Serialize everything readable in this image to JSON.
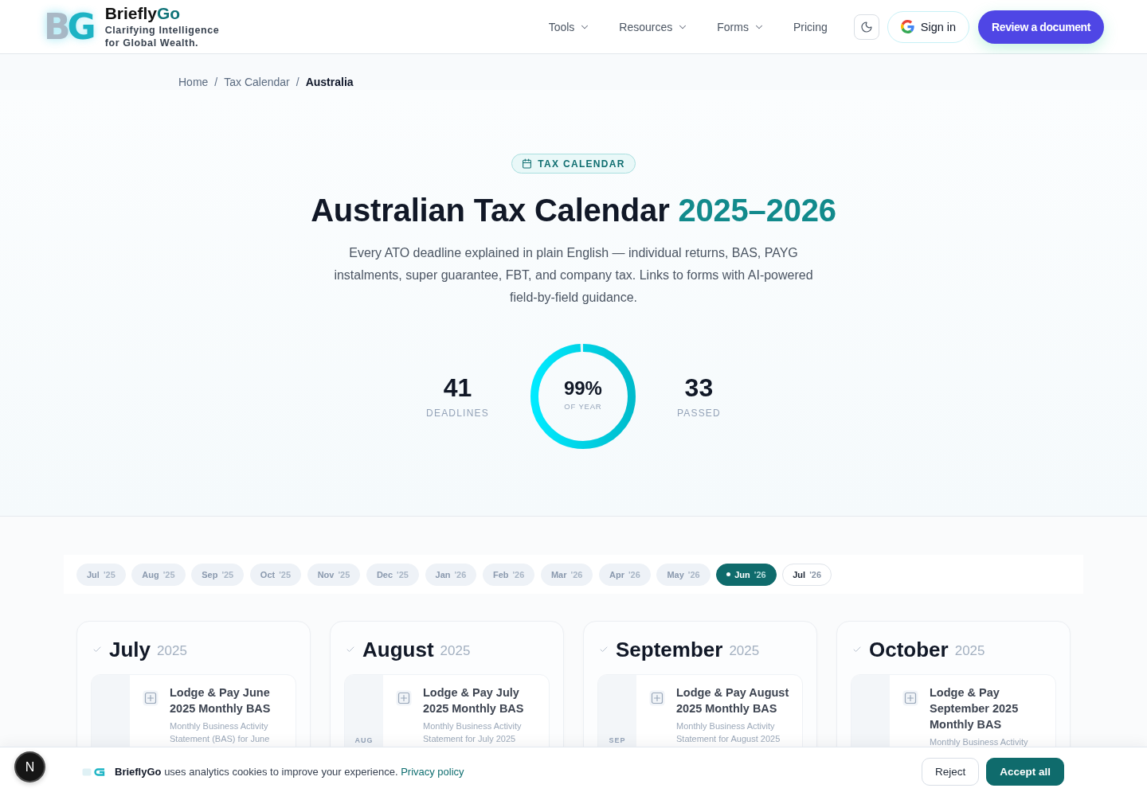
{
  "header": {
    "logo_mark": "BG",
    "brand_name": "Briefly",
    "brand_highlight": "Go",
    "tagline": "Clarifying Intelligence for Global Wealth.",
    "nav": [
      {
        "label": "Tools",
        "kind": "dropdown"
      },
      {
        "label": "Resources",
        "kind": "dropdown"
      },
      {
        "label": "Forms",
        "kind": "dropdown"
      },
      {
        "label": "Pricing",
        "kind": "link"
      }
    ],
    "sign_in": "Sign in",
    "cta": "Review a document"
  },
  "breadcrumb": {
    "separator": "/",
    "items": [
      {
        "label": "Home",
        "current": false
      },
      {
        "label": "Tax Calendar",
        "current": false
      },
      {
        "label": "Australia",
        "current": true
      }
    ]
  },
  "hero": {
    "badge": "TAX CALENDAR",
    "title": "Australian Tax Calendar",
    "title_highlight": "2025–2026",
    "subtitle": "Every ATO deadline explained in plain English — individual returns, BAS, PAYG instalments, super guarantee, FBT, and company tax. Links to forms with AI-powered field-by-field guidance.",
    "stats": [
      {
        "kind": "count",
        "value": "41",
        "label": "DEADLINES"
      },
      {
        "kind": "ring",
        "value": "99%",
        "label": "OF YEAR",
        "level": 0.99
      },
      {
        "kind": "count",
        "value": "33",
        "label": "PASSED"
      }
    ]
  },
  "month_tabs": [
    {
      "month": "Jul",
      "year": "'25",
      "passed": true,
      "selected": false
    },
    {
      "month": "Aug",
      "year": "'25",
      "passed": true,
      "selected": false
    },
    {
      "month": "Sep",
      "year": "'25",
      "passed": true,
      "selected": false
    },
    {
      "month": "Oct",
      "year": "'25",
      "passed": true,
      "selected": false
    },
    {
      "month": "Nov",
      "year": "'25",
      "passed": true,
      "selected": false
    },
    {
      "month": "Dec",
      "year": "'25",
      "passed": true,
      "selected": false
    },
    {
      "month": "Jan",
      "year": "'26",
      "passed": true,
      "selected": false
    },
    {
      "month": "Feb",
      "year": "'26",
      "passed": true,
      "selected": false
    },
    {
      "month": "Mar",
      "year": "'26",
      "passed": true,
      "selected": false
    },
    {
      "month": "Apr",
      "year": "'26",
      "passed": true,
      "selected": false
    },
    {
      "month": "May",
      "year": "'26",
      "passed": true,
      "selected": false
    },
    {
      "month": "Jun",
      "year": "'26",
      "passed": false,
      "selected": true
    },
    {
      "month": "Jul",
      "year": "'26",
      "passed": false,
      "selected": false
    }
  ],
  "months": [
    {
      "month": "July",
      "year": "2025",
      "completed": true,
      "deadlines": [
        {
          "title": "Lodge & Pay June 2025 Monthly BAS",
          "description": "Monthly Business Activity Statement (BAS) for June"
        }
      ]
    },
    {
      "month": "August",
      "year": "2025",
      "completed": true,
      "deadlines": [
        {
          "date_label": "AUG",
          "title": "Lodge & Pay July 2025 Monthly BAS",
          "description": "Monthly Business Activity Statement for July 2025"
        }
      ]
    },
    {
      "month": "September",
      "year": "2025",
      "completed": true,
      "deadlines": [
        {
          "date_label": "SEP",
          "title": "Lodge & Pay August 2025 Monthly BAS",
          "description": "Monthly Business Activity Statement for August 2025"
        }
      ]
    },
    {
      "month": "October",
      "year": "2025",
      "completed": true,
      "deadlines": [
        {
          "title": "Lodge & Pay September 2025 Monthly BAS",
          "description": "Monthly Business Activity"
        }
      ]
    }
  ],
  "cookie_banner": {
    "dev_badge": "N",
    "message": "**BrieflyGo** uses analytics cookies to improve your experience.",
    "link": "Privacy policy",
    "buttons": [
      {
        "label": "Reject",
        "kind": "secondary"
      },
      {
        "label": "Accept all",
        "kind": "primary"
      }
    ]
  }
}
